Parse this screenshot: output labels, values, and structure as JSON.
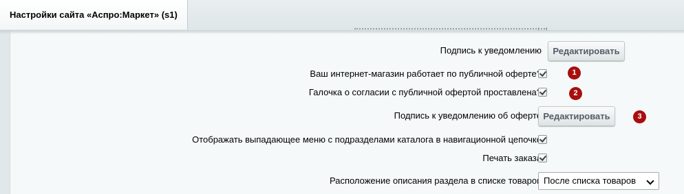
{
  "tab": {
    "title": "Настройки сайта «Аспро:Маркет» (s1)"
  },
  "rows": [
    {
      "label": "Подпись к уведомлению",
      "button": "Редактировать"
    },
    {
      "label": "Ваш интернет-магазин работает по публичной оферте?",
      "checked": true,
      "badge": "1"
    },
    {
      "label": "Галочка о согласии с публичной офертой проставлена?",
      "checked": true,
      "badge": "2"
    },
    {
      "label": "Подпись к уведомлению об оферте",
      "button": "Редактировать",
      "badge": "3"
    },
    {
      "label": "Отображать выпадающее меню с подразделами каталога в навигационной цепочке",
      "checked": true
    },
    {
      "label": "Печать заказа",
      "checked": true
    },
    {
      "label": "Расположение описания раздела в списке товаров",
      "select_value": "После списка товаров"
    }
  ],
  "colors": {
    "badge": "#a90e0e",
    "panel": "#f5f9f9",
    "background": "#e0e8ea"
  }
}
